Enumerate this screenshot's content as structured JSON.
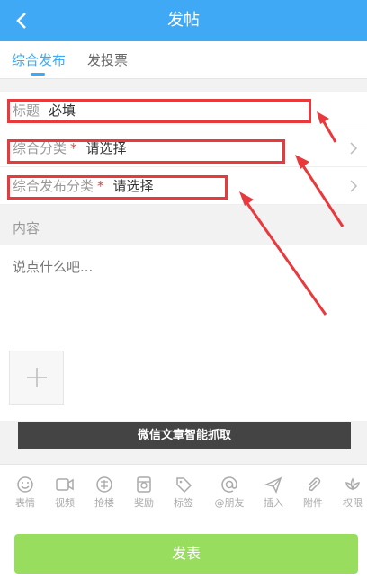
{
  "header": {
    "title": "发帖",
    "back_icon": "chevron-left-icon"
  },
  "tabs": [
    {
      "label": "综合发布",
      "active": true
    },
    {
      "label": "发投票",
      "active": false
    }
  ],
  "form": {
    "title_label": "标题",
    "title_placeholder": "必填",
    "category_label": "综合分类",
    "category_required": "*",
    "category_value": "请选择",
    "sub_category_label": "综合发布分类",
    "sub_category_required": "*",
    "sub_category_value": "请选择"
  },
  "content": {
    "header": "内容",
    "placeholder": "说点什么吧..."
  },
  "wechat_button": "微信文章智能抓取",
  "toolbar": [
    {
      "label": "表情",
      "icon": "smile-icon"
    },
    {
      "label": "视频",
      "icon": "video-icon"
    },
    {
      "label": "抢楼",
      "icon": "grab-floor-icon"
    },
    {
      "label": "奖励",
      "icon": "reward-icon"
    },
    {
      "label": "标签",
      "icon": "tag-icon"
    },
    {
      "label": "@朋友",
      "icon": "at-icon"
    },
    {
      "label": "插入",
      "icon": "send-icon"
    },
    {
      "label": "附件",
      "icon": "paperclip-icon"
    },
    {
      "label": "权限",
      "icon": "lotus-icon"
    }
  ],
  "submit_label": "发表",
  "colors": {
    "header": "#3fa9f5",
    "accent": "#3fa9f5",
    "submit": "#99dd5e",
    "annotation": "#e8393d",
    "required": "#e64340"
  }
}
